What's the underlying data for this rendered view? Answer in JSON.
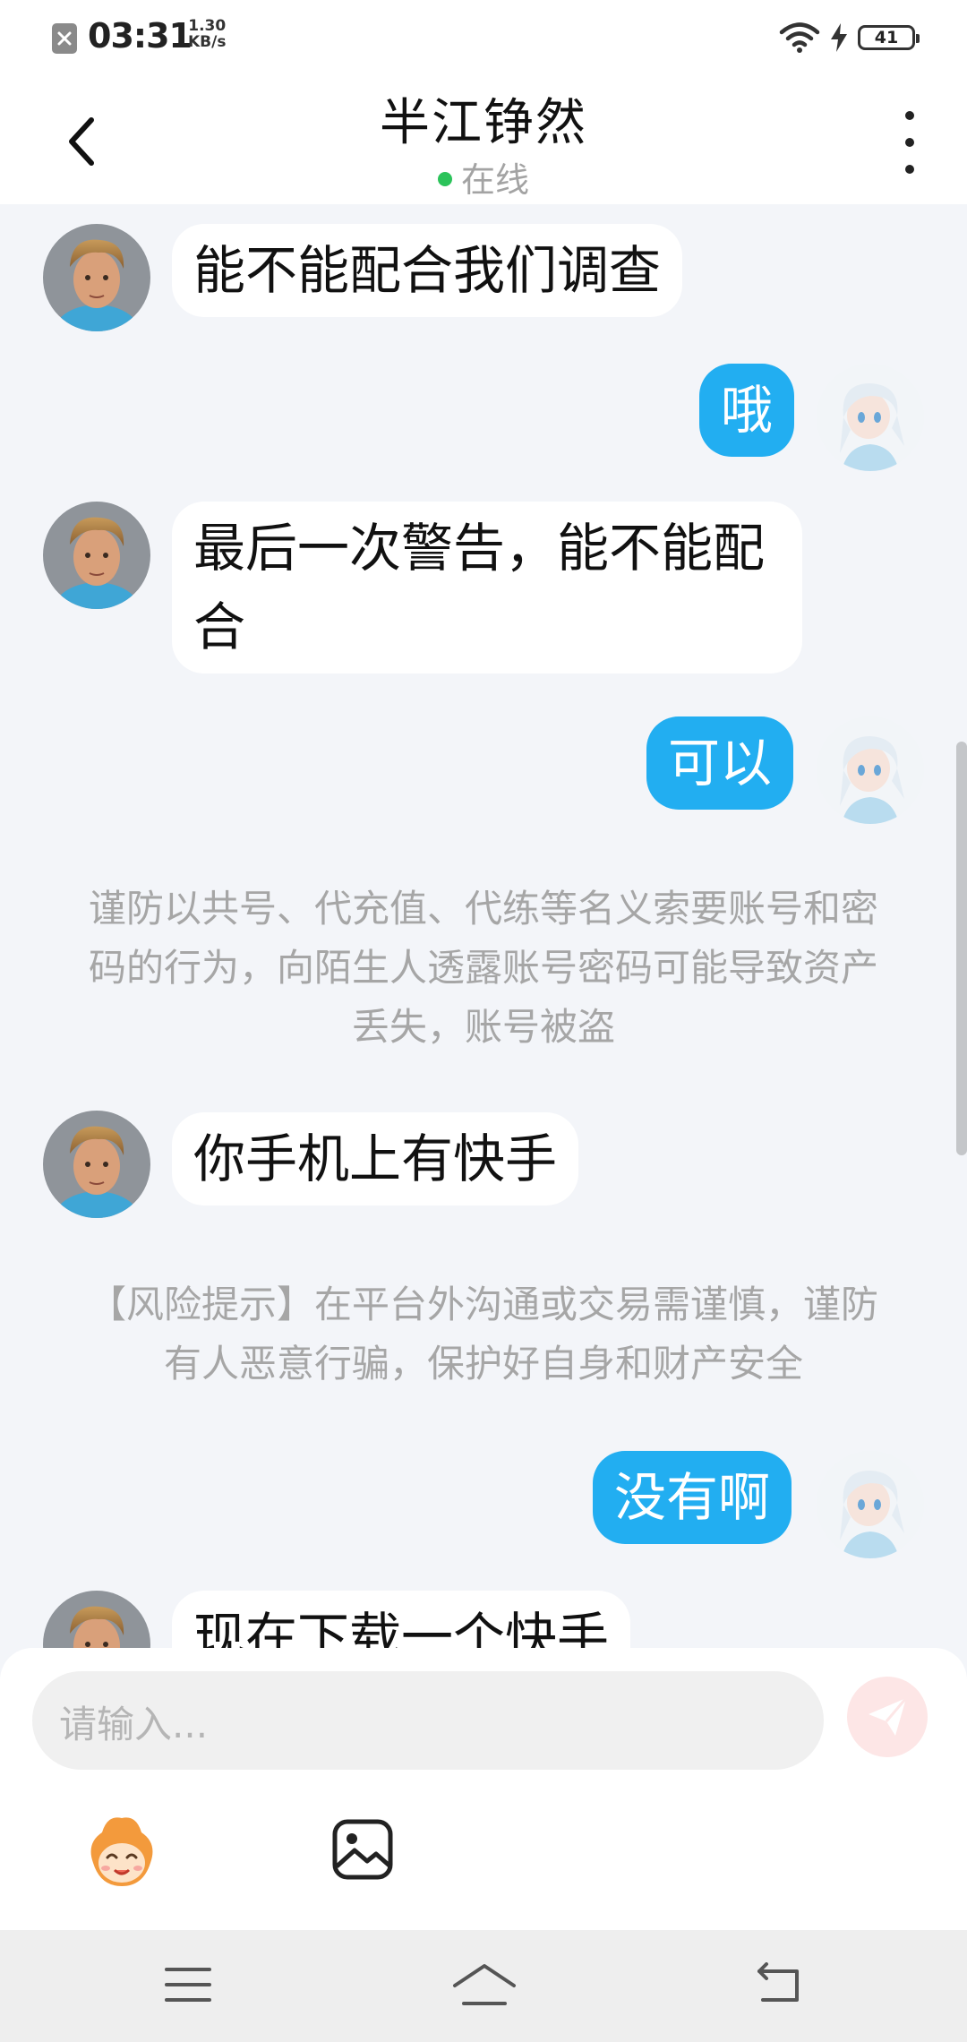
{
  "status_bar": {
    "time": "03:31",
    "net_speed_value": "1.30",
    "net_speed_unit": "KB/s",
    "battery": "41",
    "icons": [
      "notification-blocked-icon",
      "wifi-icon",
      "charging-icon",
      "battery-icon"
    ]
  },
  "header": {
    "title": "半江铮然",
    "status": "在线",
    "status_color": "#2bc35a",
    "icons": [
      "back-arrow-icon",
      "more-vertical-icon"
    ]
  },
  "messages": [
    {
      "side": "in",
      "text": "能不能配合我们调查"
    },
    {
      "side": "out",
      "text": "哦"
    },
    {
      "side": "in",
      "text": "最后一次警告，能不能配合"
    },
    {
      "side": "out",
      "text": "可以"
    },
    {
      "side": "in",
      "text": "你手机上有快手"
    },
    {
      "side": "out",
      "text": "没有啊"
    },
    {
      "side": "in",
      "text": "现在下载一个快手"
    }
  ],
  "notices": [
    "谨防以共号、代充值、代练等名义索要账号和密码的行为，向陌生人透露账号密码可能导致资产丢失，账号被盗",
    "【风险提示】在平台外沟通或交易需谨慎，谨防有人恶意行骗，保护好自身和财产安全"
  ],
  "composer": {
    "placeholder": "请输入...",
    "send_icon": "send-icon",
    "tool_icons": [
      "emoji-mascot-icon",
      "image-icon"
    ]
  },
  "colors": {
    "outgoing_bubble": "#22aef1",
    "incoming_bubble": "#ffffff",
    "background": "#f3f5f9"
  },
  "nav_bar": {
    "icons": [
      "menu-icon",
      "home-icon",
      "back-icon"
    ]
  }
}
